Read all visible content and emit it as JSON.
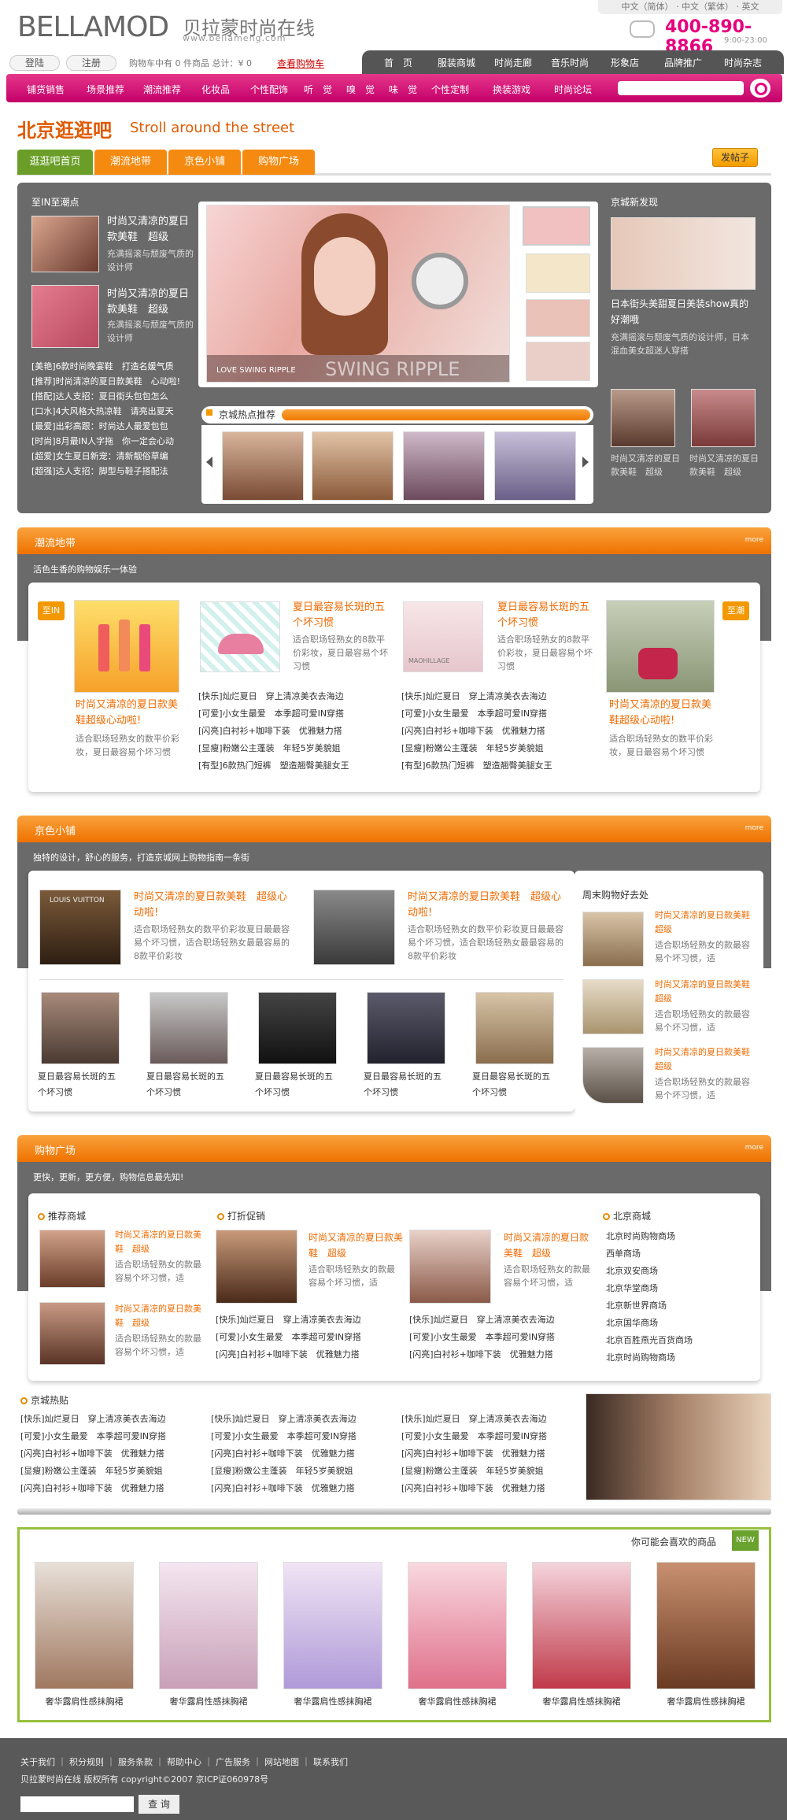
{
  "header": {
    "logo": "BELLAMOD",
    "logo_cn": "贝拉蒙时尚在线",
    "url": "www.bellameng.com",
    "languages": "中文（简体） · 中文（繁体） · 英文",
    "phone": "400-890-8866",
    "hours": "9:00-23:00",
    "login": "登陆",
    "register": "注册",
    "cart_info": "购物车中有 0 件商品 总计：¥ 0",
    "cart_link": "查看购物车",
    "main_nav": [
      "首　页",
      "服装商城",
      "时尚走廊",
      "音乐时尚",
      "形象店",
      "品牌推广",
      "时尚杂志"
    ],
    "sub_nav": [
      "铺货销售",
      "场景推荐",
      "潮流推荐",
      "化妆品",
      "个性配饰",
      "听　觉",
      "嗅　觉",
      "味　觉",
      "个性定制",
      "换装游戏",
      "时尚论坛"
    ]
  },
  "page": {
    "title": "北京逛逛吧",
    "title_en": "Stroll around the street",
    "post_button": "发帖子",
    "tabs": [
      "逛逛吧首页",
      "潮流地带",
      "京色小铺",
      "购物广场"
    ]
  },
  "hot": {
    "left_header": "至IN至潮点",
    "items": [
      {
        "title": "时尚又清凉的夏日款美鞋　超级",
        "desc": "充满摇滚与颓废气质的设计师"
      },
      {
        "title": "时尚又清凉的夏日款美鞋　超级",
        "desc": "充满摇滚与颓废气质的设计师"
      }
    ],
    "list": [
      "[美艳]6款时尚晚宴鞋　打造名媛气质",
      "[推荐]时尚清凉的夏日款美鞋　心动啦!",
      "[搭配]达人支招：夏日街头包包怎么",
      "[口水]4大风格大热凉鞋　请亮出夏天",
      "[最爱]出彩高跟：时尚达人最爱包包",
      "[时尚]8月最IN人字拖　你一定会心动",
      "[超爱]女生夏日新宠：清新靓俗草编",
      "[超强]达人支招：脚型与鞋子搭配法"
    ],
    "slide_caption": "LOVE SWING RIPPLE",
    "slide_overlay": "SWING RIPPLE",
    "hot_rec": "京城热点推荐",
    "right_header": "京城新发现",
    "right_title": "日本街头美甜夏日美装show真的好潮哦",
    "right_desc": "充满摇滚与颓废气质的设计师，日本混血美女超迷人穿搭",
    "right_captions": [
      "时尚又清凉的夏日款美鞋　超级",
      "时尚又清凉的夏日款美鞋　超级"
    ]
  },
  "trend": {
    "title": "潮流地带",
    "more": "more",
    "subtitle": "活色生香的购物娱乐一体验",
    "tag_left": "至IN",
    "tag_right": "至潮",
    "left_title": "时尚又清凉的夏日款美鞋超级心动啦!",
    "left_desc": "适合职场轻熟女的数平价彩妆，夏日最容易个坏习惯",
    "mid": [
      {
        "title": "夏日最容易长斑的五个坏习惯",
        "desc": "适合职场轻熟女的8款平价彩妆，夏日最容易个坏习惯"
      },
      {
        "title": "夏日最容易长斑的五个坏习惯",
        "desc": "适合职场轻熟女的8款平价彩妆，夏日最容易个坏习惯"
      }
    ],
    "mid_lists": [
      [
        "[快乐]灿烂夏日　穿上清凉美衣去海边",
        "[可爱]小女生最爱　本季超可爱IN穿搭",
        "[闪亮]白衬衫+咖啡下装　优雅魅力搭",
        "[显瘦]粉嫩公主蓬装　年轻5岁美貌姐",
        "[有型]6款热门短裤　塑造翘臀美腿女王"
      ],
      [
        "[快乐]灿烂夏日　穿上清凉美衣去海边",
        "[可爱]小女生最爱　本季超可爱IN穿搭",
        "[闪亮]白衬衫+咖啡下装　优雅魅力搭",
        "[显瘦]粉嫩公主蓬装　年轻5岁美貌姐",
        "[有型]6款热门短裤　塑造翘臀美腿女王"
      ]
    ],
    "right_title": "时尚又清凉的夏日款美鞋超级心动啦!",
    "right_desc": "适合职场轻熟女的数平价彩妆，夏日最容易个坏习惯",
    "brand_tag": "MAOHILLAGE"
  },
  "shop": {
    "title": "京色小铺",
    "more": "more",
    "subtitle": "独特的设计，舒心的服务，打造京城网上购物指南一条街",
    "features": [
      {
        "title": "时尚又清凉的夏日款美鞋　超级心动啦!",
        "desc": "适合职场轻熟女的数平价彩妆夏日最最容易个坏习惯，适合职场轻熟女最最容易的8款平价彩妆"
      },
      {
        "title": "时尚又清凉的夏日款美鞋　超级心动啦!",
        "desc": "适合职场轻熟女的数平价彩妆夏日最最容易个坏习惯，适合职场轻熟女最最容易的8款平价彩妆"
      }
    ],
    "grid_captions": [
      "夏日最容易长斑的五个坏习惯",
      "夏日最容易长斑的五个坏习惯",
      "夏日最容易长斑的五个坏习惯",
      "夏日最容易长斑的五个坏习惯",
      "夏日最容易长斑的五个坏习惯"
    ],
    "weekend_header": "周末购物好去处",
    "weekend": [
      {
        "title": "时尚又清凉的夏日款美鞋　超级",
        "desc": "适合职场轻熟女的款最容易个坏习惯，适"
      },
      {
        "title": "时尚又清凉的夏日款美鞋　超级",
        "desc": "适合职场轻熟女的款最容易个坏习惯，适"
      },
      {
        "title": "时尚又清凉的夏日款美鞋　超级",
        "desc": "适合职场轻熟女的款最容易个坏习惯，适"
      }
    ],
    "store_sign": "LOUIS VUITTON"
  },
  "plaza": {
    "title": "购物广场",
    "more": "more",
    "subtitle": "更快，更新，更方便，购物信息最先知!",
    "rec_header": "推荐商城",
    "promo_header": "打折促销",
    "mall_header": "北京商城",
    "rec": [
      {
        "title": "时尚又清凉的夏日款美鞋　超级",
        "desc": "适合职场轻熟女的款最容易个坏习惯，适"
      },
      {
        "title": "时尚又清凉的夏日款美鞋　超级",
        "desc": "适合职场轻熟女的款最容易个坏习惯，适"
      }
    ],
    "promo": [
      {
        "title": "时尚又清凉的夏日款美鞋　超级",
        "desc": "适合职场轻熟女的款最容易个坏习惯，适"
      },
      {
        "title": "时尚又清凉的夏日款美鞋　超级",
        "desc": "适合职场轻熟女的款最容易个坏习惯，适"
      }
    ],
    "promo_lists": [
      [
        "[快乐]灿烂夏日　穿上清凉美衣去海边",
        "[可爱]小女生最爱　本季超可爱IN穿搭",
        "[闪亮]白衬衫+咖啡下装　优雅魅力搭"
      ],
      [
        "[快乐]灿烂夏日　穿上清凉美衣去海边",
        "[可爱]小女生最爱　本季超可爱IN穿搭",
        "[闪亮]白衬衫+咖啡下装　优雅魅力搭"
      ]
    ],
    "malls": [
      "北京时尚购物商场",
      "西单商场",
      "北京双安商场",
      "北京华堂商场",
      "北京新世界商场",
      "北京国华商场",
      "北京百胜燕光百货商场",
      "北京时尚购物商场"
    ]
  },
  "topics": {
    "header": "京城热贴",
    "cols": [
      [
        "[快乐]灿烂夏日　穿上清凉美衣去海边",
        "[可爱]小女生最爱　本季超可爱IN穿搭",
        "[闪亮]白衬衫+咖啡下装　优雅魅力搭",
        "[显瘦]粉嫩公主蓬装　年轻5岁美貌姐",
        "[闪亮]白衬衫+咖啡下装　优雅魅力搭"
      ],
      [
        "[快乐]灿烂夏日　穿上清凉美衣去海边",
        "[可爱]小女生最爱　本季超可爱IN穿搭",
        "[闪亮]白衬衫+咖啡下装　优雅魅力搭",
        "[显瘦]粉嫩公主蓬装　年轻5岁美貌姐",
        "[闪亮]白衬衫+咖啡下装　优雅魅力搭"
      ],
      [
        "[快乐]灿烂夏日　穿上清凉美衣去海边",
        "[可爱]小女生最爱　本季超可爱IN穿搭",
        "[闪亮]白衬衫+咖啡下装　优雅魅力搭",
        "[显瘦]粉嫩公主蓬装　年轻5岁美貌姐",
        "[闪亮]白衬衫+咖啡下装　优雅魅力搭"
      ]
    ]
  },
  "recommend": {
    "header": "你可能会喜欢的商品",
    "new": "NEW",
    "captions": [
      "奢华露肩性感抹胸裙",
      "奢华露肩性感抹胸裙",
      "奢华露肩性感抹胸裙",
      "奢华露肩性感抹胸裙",
      "奢华露肩性感抹胸裙",
      "奢华露肩性感抹胸裙"
    ]
  },
  "footer": {
    "links": "关于我们 ｜ 积分规则 ｜ 服务条款 ｜ 帮助中心 ｜ 广告服务 ｜ 网站地图 ｜ 联系我们",
    "copyright": "贝拉蒙时尚在线 版权所有 copyright©2007 京ICP证060978号",
    "search_btn": "查 询"
  },
  "colors": {
    "pink": "#e6007e",
    "orange": "#f07a00",
    "green": "#6a9e28",
    "gray": "#6a6a6a"
  }
}
